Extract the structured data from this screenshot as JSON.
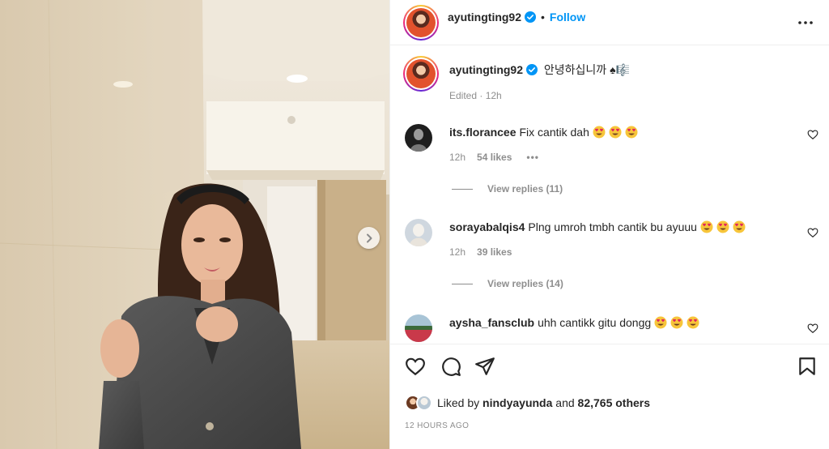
{
  "post": {
    "username": "ayutingting92",
    "verified": true,
    "separator": "•",
    "follow_label": "Follow",
    "caption": "안녕하십니까 ♠🎼",
    "caption_meta": "Edited · 12h"
  },
  "comments": [
    {
      "username": "its.florancee",
      "text": "Fix cantik dah",
      "emojis": 3,
      "time": "12h",
      "likes": "54 likes",
      "more": "•••",
      "replies": "View replies (11)"
    },
    {
      "username": "sorayabalqis4",
      "text": "Plng umroh tmbh cantik bu ayuuu",
      "emojis": 3,
      "time": "12h",
      "likes": "39 likes",
      "replies": "View replies (14)"
    },
    {
      "username": "aysha_fansclub",
      "text": "uhh cantikk gitu dongg",
      "emojis": 3
    }
  ],
  "actions": {
    "liked_by_prefix": "Liked by",
    "liked_by_user": "nindyayunda",
    "liked_by_and": "and",
    "liked_by_others": "82,765 others",
    "timestamp": "12 HOURS AGO"
  },
  "colors": {
    "accent": "#0095f6",
    "text": "#262626",
    "muted": "#8e8e8e",
    "heart_emoji": "#f7c53a"
  },
  "icons": {
    "verified": "verified-badge-icon",
    "more": "more-options-icon",
    "next": "chevron-right-icon",
    "like": "heart-icon",
    "comment": "comment-icon",
    "share": "share-icon",
    "save": "bookmark-icon"
  }
}
